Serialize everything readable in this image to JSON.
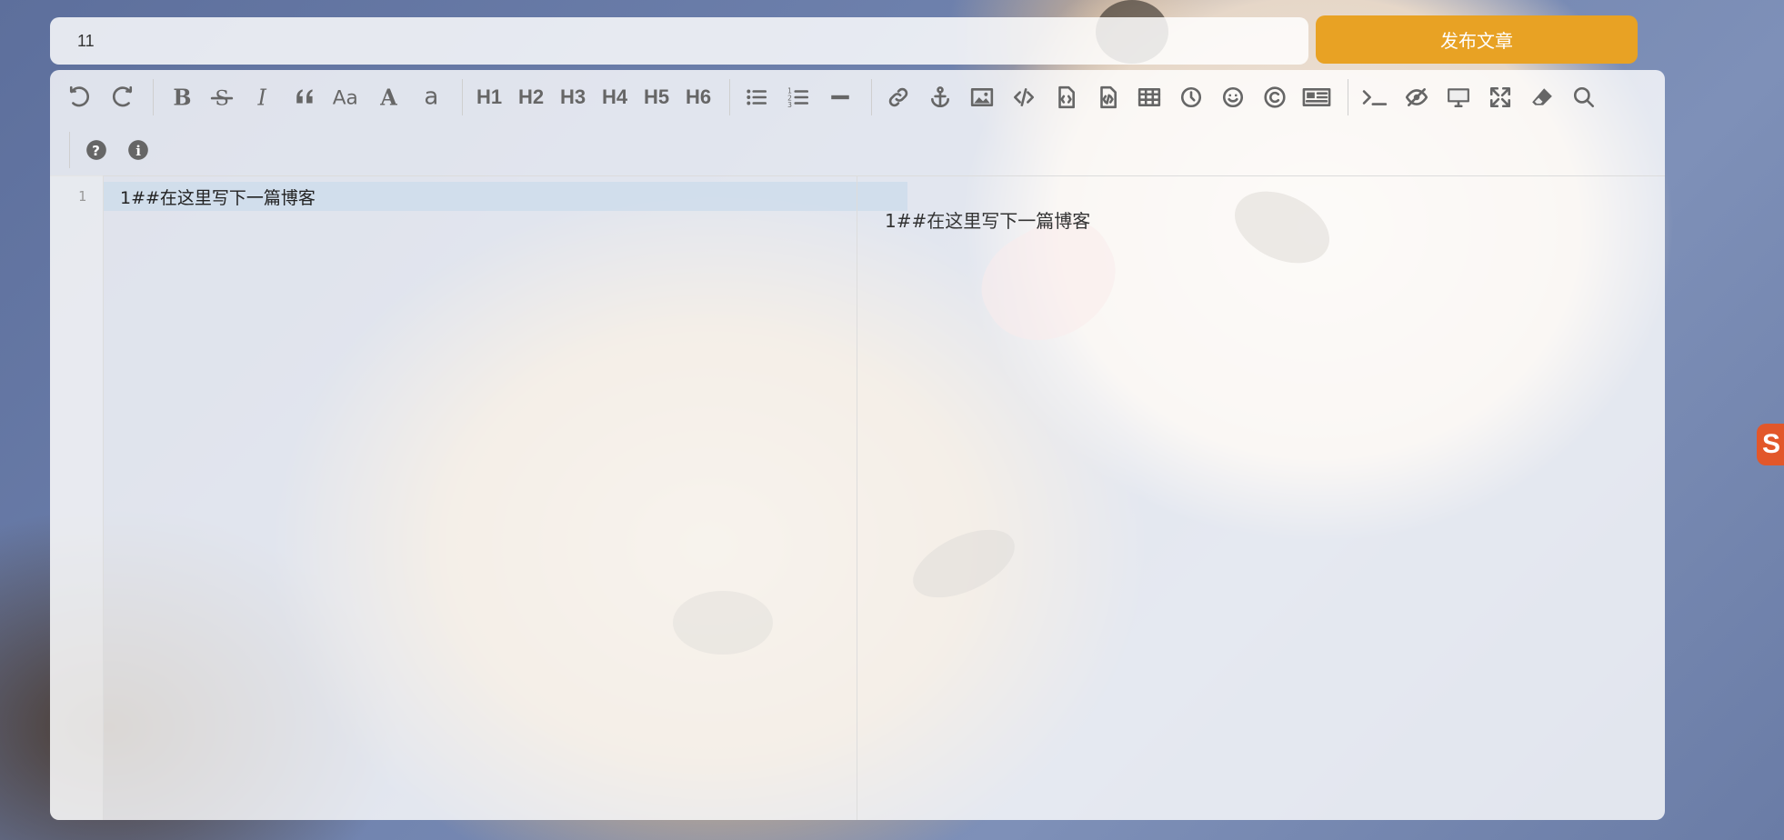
{
  "header": {
    "title_value": "11",
    "publish_label": "发布文章"
  },
  "side_badge": "S",
  "toolbar": {
    "rows": [
      [
        {
          "name": "undo-icon",
          "type": "icon"
        },
        {
          "name": "redo-icon",
          "type": "icon"
        },
        {
          "sep": true
        },
        {
          "name": "bold-icon",
          "type": "icon"
        },
        {
          "name": "strikethrough-icon",
          "type": "icon"
        },
        {
          "name": "italic-icon",
          "type": "icon"
        },
        {
          "name": "quote-icon",
          "type": "icon"
        },
        {
          "name": "uppercase-aa-icon",
          "type": "icon"
        },
        {
          "name": "uppercase-a-icon",
          "type": "icon"
        },
        {
          "name": "lowercase-a-icon",
          "type": "icon"
        },
        {
          "sep": true
        },
        {
          "name": "heading-1",
          "label": "H1"
        },
        {
          "name": "heading-2",
          "label": "H2"
        },
        {
          "name": "heading-3",
          "label": "H3"
        },
        {
          "name": "heading-4",
          "label": "H4"
        },
        {
          "name": "heading-5",
          "label": "H5"
        },
        {
          "name": "heading-6",
          "label": "H6"
        },
        {
          "sep": true
        },
        {
          "name": "unordered-list-icon",
          "type": "icon"
        },
        {
          "name": "ordered-list-icon",
          "type": "icon"
        },
        {
          "name": "horizontal-rule-icon",
          "type": "icon"
        },
        {
          "sep": true
        },
        {
          "name": "link-icon",
          "type": "icon"
        },
        {
          "name": "anchor-icon",
          "type": "icon"
        },
        {
          "name": "image-icon",
          "type": "icon"
        },
        {
          "name": "inline-code-icon",
          "type": "icon"
        },
        {
          "name": "code-block-icon",
          "type": "icon"
        },
        {
          "name": "preformatted-code-icon",
          "type": "icon"
        },
        {
          "name": "table-icon",
          "type": "icon"
        },
        {
          "name": "datetime-icon",
          "type": "icon"
        },
        {
          "name": "emoji-icon",
          "type": "icon"
        },
        {
          "name": "html-entities-icon",
          "type": "icon"
        },
        {
          "name": "pagebreak-icon",
          "type": "icon"
        },
        {
          "sep": true
        },
        {
          "name": "goto-line-icon",
          "type": "icon"
        },
        {
          "name": "toggle-preview-icon",
          "type": "icon"
        },
        {
          "name": "watch-preview-icon",
          "type": "icon"
        },
        {
          "name": "fullscreen-icon",
          "type": "icon"
        },
        {
          "name": "clear-icon",
          "type": "icon"
        },
        {
          "name": "search-icon",
          "type": "icon"
        }
      ],
      [
        {
          "sep": true
        },
        {
          "name": "help-icon",
          "type": "icon"
        },
        {
          "name": "info-icon",
          "type": "icon"
        }
      ]
    ]
  },
  "editor": {
    "line_numbers": [
      "1"
    ],
    "lines": [
      "1##在这里写下一篇博客"
    ]
  },
  "preview": {
    "text": "1##在这里写下一篇博客"
  }
}
